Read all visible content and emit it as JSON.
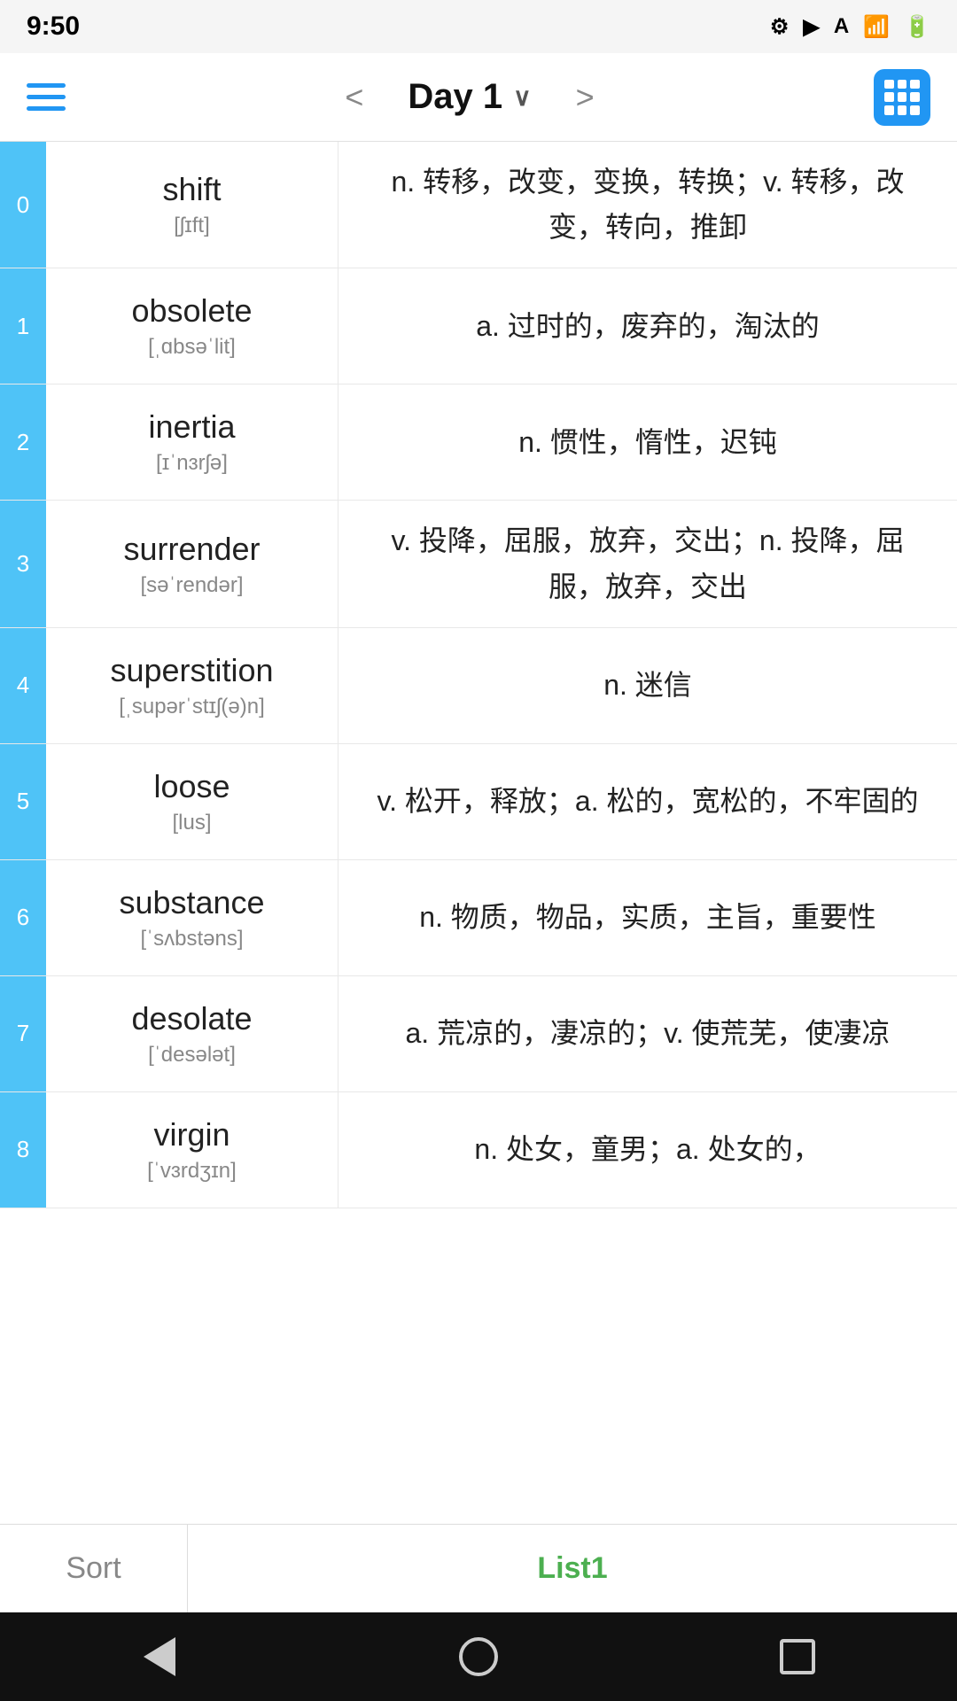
{
  "statusBar": {
    "time": "9:50",
    "icons": [
      "⚙",
      "▶",
      "A",
      "?",
      "•"
    ]
  },
  "topNav": {
    "title": "Day 1",
    "prevArrow": "<",
    "nextArrow": ">",
    "gridLabel": "grid"
  },
  "words": [
    {
      "index": "0",
      "english": "shift",
      "phonetic": "[ʃɪft]",
      "definition": "n. 转移，改变，变换，转换；v. 转移，改变，转向，推卸"
    },
    {
      "index": "1",
      "english": "obsolete",
      "phonetic": "[ˌɑbsəˈlit]",
      "definition": "a. 过时的，废弃的，淘汰的"
    },
    {
      "index": "2",
      "english": "inertia",
      "phonetic": "[ɪˈnɜrʃə]",
      "definition": "n. 惯性，惰性，迟钝"
    },
    {
      "index": "3",
      "english": "surrender",
      "phonetic": "[səˈrendər]",
      "definition": "v. 投降，屈服，放弃，交出；n. 投降，屈服，放弃，交出"
    },
    {
      "index": "4",
      "english": "superstition",
      "phonetic": "[ˌsupərˈstɪʃ(ə)n]",
      "definition": "n. 迷信"
    },
    {
      "index": "5",
      "english": "loose",
      "phonetic": "[lus]",
      "definition": "v. 松开，释放；a. 松的，宽松的，不牢固的"
    },
    {
      "index": "6",
      "english": "substance",
      "phonetic": "[ˈsʌbstəns]",
      "definition": "n. 物质，物品，实质，主旨，重要性"
    },
    {
      "index": "7",
      "english": "desolate",
      "phonetic": "[ˈdesələt]",
      "definition": "a. 荒凉的，凄凉的；v. 使荒芜，使凄凉"
    },
    {
      "index": "8",
      "english": "virgin",
      "phonetic": "[ˈvɜrdʒɪn]",
      "definition": "n. 处女，童男；a. 处女的，"
    }
  ],
  "bottomTabs": {
    "sort": "Sort",
    "list1": "List1"
  },
  "androidNav": {
    "back": "back",
    "home": "home",
    "recents": "recents"
  }
}
